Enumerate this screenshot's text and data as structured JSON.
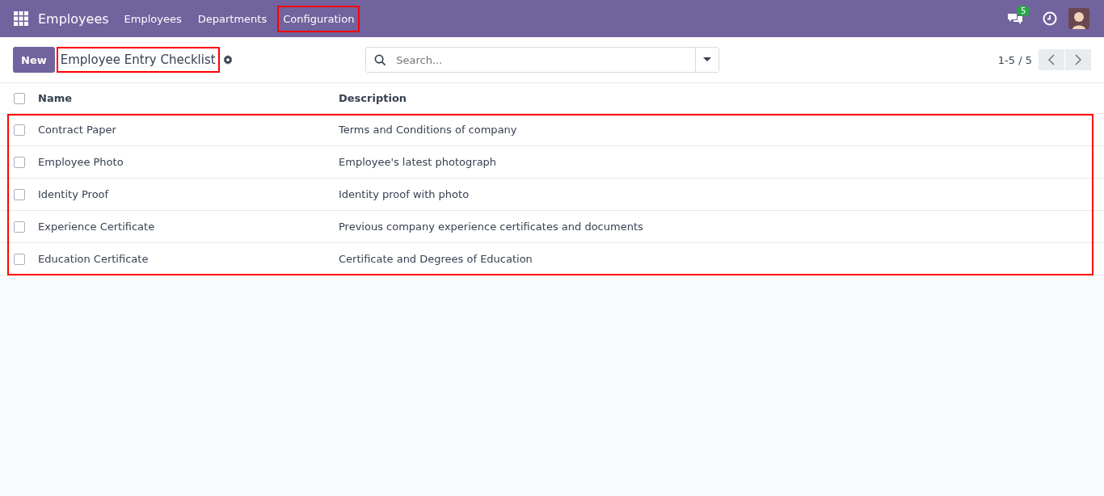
{
  "navbar": {
    "app_name": "Employees",
    "menu": [
      {
        "label": "Employees",
        "highlighted": false
      },
      {
        "label": "Departments",
        "highlighted": false
      },
      {
        "label": "Configuration",
        "highlighted": true
      }
    ],
    "messages_badge": "5"
  },
  "control_panel": {
    "new_button": "New",
    "title": "Employee Entry Checklist",
    "title_highlighted": true,
    "search": {
      "placeholder": "Search..."
    },
    "pager": "1-5 / 5"
  },
  "table": {
    "columns": [
      "Name",
      "Description"
    ],
    "header_checked": false,
    "rows_highlighted": true,
    "rows": [
      {
        "name": "Contract Paper",
        "description": "Terms and Conditions of company",
        "checked": false
      },
      {
        "name": "Employee Photo",
        "description": "Employee's latest photograph",
        "checked": false
      },
      {
        "name": "Identity Proof",
        "description": "Identity proof with photo",
        "checked": false
      },
      {
        "name": "Experience Certificate",
        "description": "Previous company experience certificates and documents",
        "checked": false
      },
      {
        "name": "Education Certificate",
        "description": "Certificate and Degrees of Education",
        "checked": false
      }
    ]
  }
}
